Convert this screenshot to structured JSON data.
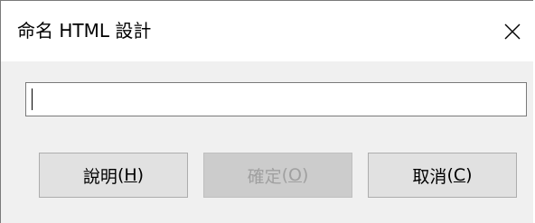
{
  "dialog": {
    "title": "命名 HTML 設計",
    "close_icon": "close-icon"
  },
  "name_input": {
    "value": "",
    "placeholder": ""
  },
  "buttons": {
    "help": {
      "label": "說明",
      "paren_open": "(",
      "mnemonic": "H",
      "paren_close": ")",
      "enabled": true
    },
    "ok": {
      "label": "確定",
      "paren_open": "(",
      "mnemonic": "O",
      "paren_close": ")",
      "enabled": false
    },
    "cancel": {
      "label": "取消",
      "paren_open": "(",
      "mnemonic": "C",
      "paren_close": ")",
      "enabled": true
    }
  },
  "colors": {
    "dialog_bg": "#f0f0f0",
    "titlebar_bg": "#ffffff",
    "button_bg": "#e1e1e1",
    "button_disabled_bg": "#cccccc",
    "button_disabled_text": "#a0a0a0"
  }
}
